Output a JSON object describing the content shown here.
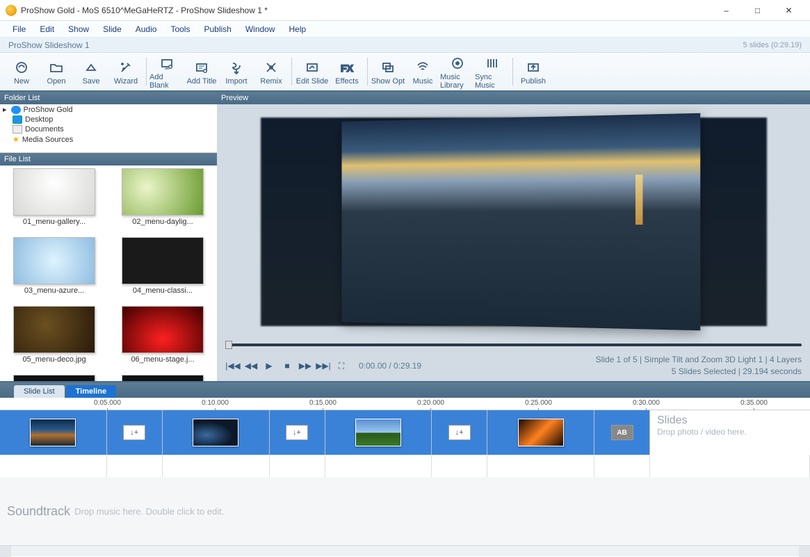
{
  "window_title": "ProShow Gold - MoS 6510^MeGaHeRTZ - ProShow Slideshow 1 *",
  "menu": [
    "File",
    "Edit",
    "Show",
    "Slide",
    "Audio",
    "Tools",
    "Publish",
    "Window",
    "Help"
  ],
  "project_name": "ProShow Slideshow 1",
  "slide_count_text": "5 slides (0:29.19)",
  "toolbar": [
    {
      "label": "New",
      "icon": "new"
    },
    {
      "label": "Open",
      "icon": "open"
    },
    {
      "label": "Save",
      "icon": "save"
    },
    {
      "label": "Wizard",
      "icon": "wizard"
    },
    {
      "sep": true
    },
    {
      "label": "Add Blank",
      "icon": "addblank"
    },
    {
      "label": "Add Title",
      "icon": "addtitle"
    },
    {
      "label": "Import",
      "icon": "import"
    },
    {
      "label": "Remix",
      "icon": "remix"
    },
    {
      "sep": true
    },
    {
      "label": "Edit Slide",
      "icon": "editslide"
    },
    {
      "label": "Effects",
      "icon": "effects"
    },
    {
      "sep": true
    },
    {
      "label": "Show Opt",
      "icon": "showopt"
    },
    {
      "label": "Music",
      "icon": "music"
    },
    {
      "label": "Music Library",
      "icon": "musiclib"
    },
    {
      "label": "Sync Music",
      "icon": "sync"
    },
    {
      "sep": true
    },
    {
      "label": "Publish",
      "icon": "publish"
    }
  ],
  "panels": {
    "folder": "Folder List",
    "file": "File List",
    "preview": "Preview"
  },
  "folder_tree": [
    {
      "label": "ProShow Gold",
      "icon": "globe",
      "root": true
    },
    {
      "label": "Desktop",
      "icon": "disp"
    },
    {
      "label": "Documents",
      "icon": "doc"
    },
    {
      "label": "Media Sources",
      "icon": "star"
    }
  ],
  "file_list": [
    {
      "label": "01_menu-gallery...",
      "cls": "t1"
    },
    {
      "label": "02_menu-daylig...",
      "cls": "t2"
    },
    {
      "label": "03_menu-azure...",
      "cls": "t3"
    },
    {
      "label": "04_menu-classi...",
      "cls": "t4"
    },
    {
      "label": "05_menu-deco.jpg",
      "cls": "t5"
    },
    {
      "label": "06_menu-stage.j...",
      "cls": "t6"
    }
  ],
  "playback": {
    "time": "0:00.00 / 0:29.19",
    "slide_info": "Slide 1 of 5  |  Simple Tilt and Zoom 3D Light 1  |  4 Layers",
    "sel_info": "5 Slides Selected  |  29.194 seconds"
  },
  "tabs": {
    "slidelist": "Slide List",
    "timeline": "Timeline"
  },
  "time_marks": [
    "0:05.000",
    "0:10.000",
    "0:15.000",
    "0:20.000",
    "0:25.000",
    "0:30.000",
    "0:35.000"
  ],
  "dropzone": {
    "heading": "Slides",
    "hint": "Drop photo / video here."
  },
  "soundtrack": {
    "heading": "Soundtrack",
    "hint": "Drop music here.  Double click to edit."
  }
}
